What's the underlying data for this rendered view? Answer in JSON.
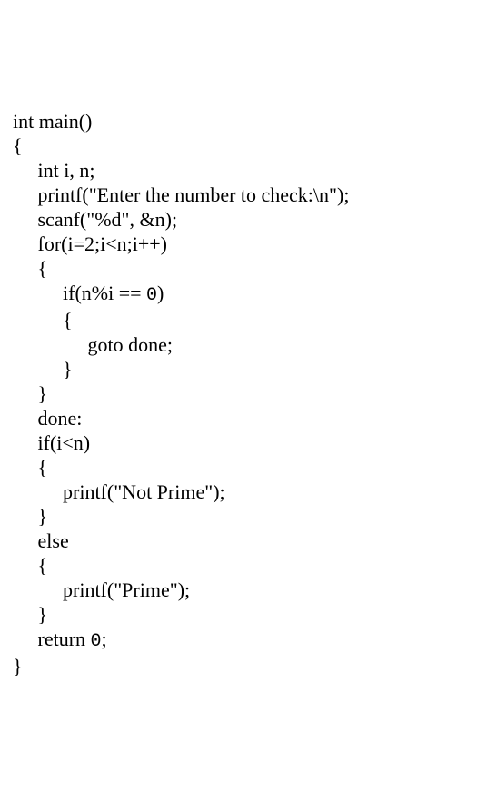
{
  "code": {
    "l01": "int main()",
    "l02": "{",
    "l03": "     int i, n;",
    "l04": "     printf(\"Enter the number to check:\\n\");",
    "l05": "     scanf(\"%d\", &n);",
    "l06": "     for(i=2;i<n;i++)",
    "l07": "     {",
    "l08_a": "          if(n%i == ",
    "l08_b": "0",
    "l08_c": ")",
    "l09": "          {",
    "l10": "               goto done;",
    "l11": "          }",
    "l12": "     }",
    "l13": "     done:",
    "l14": "     if(i<n)",
    "l15": "     {",
    "l16": "          printf(\"Not Prime\");",
    "l17": "     }",
    "l18": "     else",
    "l19": "     {",
    "l20": "          printf(\"Prime\");",
    "l21": "     }",
    "l22_a": "     return ",
    "l22_b": "0",
    "l22_c": ";",
    "l23": "}"
  }
}
